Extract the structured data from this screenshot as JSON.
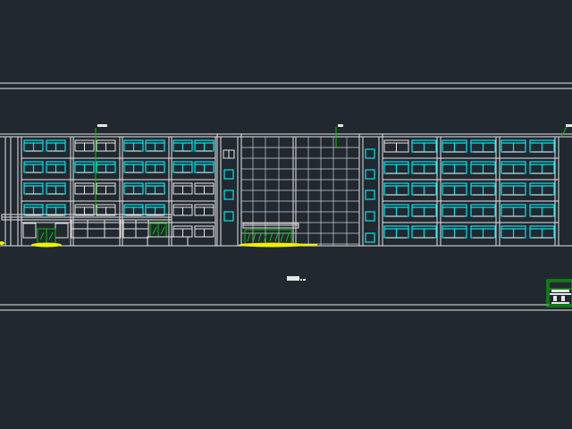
{
  "canvas": {
    "background": "#212830"
  },
  "colors": {
    "linework": "#e6e6e6",
    "glass": "#00e5ee",
    "green": "#00c800",
    "yellow": "#f0f000",
    "grid": "#cfcfcf"
  },
  "drawing": {
    "kind": "cad-building-elevation",
    "left_wing_floors": 5,
    "right_wing_floors": 5,
    "left_wing_bays": 4,
    "right_wing_bays": 3,
    "stair_towers": 2,
    "central_curtain_wall": true,
    "title_block_icon": "building-stamp-icon"
  }
}
